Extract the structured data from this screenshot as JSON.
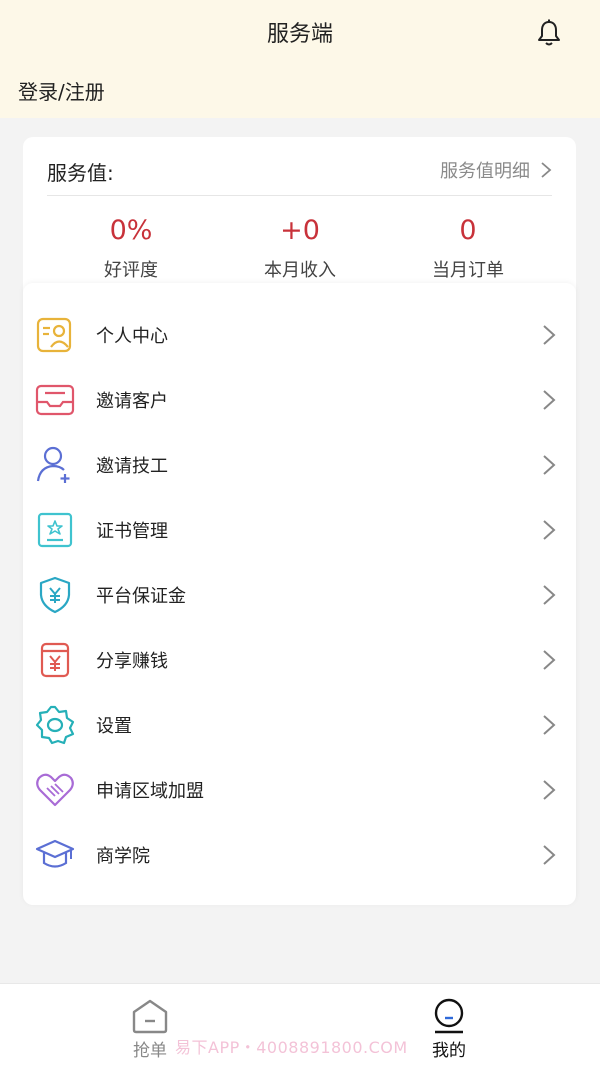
{
  "header": {
    "title": "服务端",
    "bell_icon": "bell-icon",
    "login_label": "登录/注册"
  },
  "service_card": {
    "label": "服务值:",
    "detail_label": "服务值明细",
    "stats": [
      {
        "value": "0%",
        "label": "好评度"
      },
      {
        "value": "+0",
        "label": "本月收入"
      },
      {
        "value": "0",
        "label": "当月订单"
      }
    ]
  },
  "menu": {
    "items": [
      {
        "label": "个人中心",
        "icon": "id-card-icon",
        "color": "#e8b33a"
      },
      {
        "label": "邀请客户",
        "icon": "envelope-icon",
        "color": "#e0566b"
      },
      {
        "label": "邀请技工",
        "icon": "add-user-icon",
        "color": "#5b6fd4"
      },
      {
        "label": "证书管理",
        "icon": "certificate-icon",
        "color": "#3fc3cf"
      },
      {
        "label": "平台保证金",
        "icon": "shield-yuan-icon",
        "color": "#2aa7c4"
      },
      {
        "label": "分享赚钱",
        "icon": "money-bag-icon",
        "color": "#e05a52"
      },
      {
        "label": "设置",
        "icon": "gear-icon",
        "color": "#25b0b8"
      },
      {
        "label": "申请区域加盟",
        "icon": "handshake-heart-icon",
        "color": "#a86bd6"
      },
      {
        "label": "商学院",
        "icon": "graduation-cap-icon",
        "color": "#5b6fd4"
      }
    ]
  },
  "tabbar": {
    "tabs": [
      {
        "label": "抢单",
        "icon": "home-icon",
        "active": false
      },
      {
        "label": "我的",
        "icon": "profile-icon",
        "active": true
      }
    ]
  },
  "watermark": "易下APP・4008891800.COM",
  "colors": {
    "header_bg": "#fdf8e8",
    "stat_value": "#c8323a"
  }
}
